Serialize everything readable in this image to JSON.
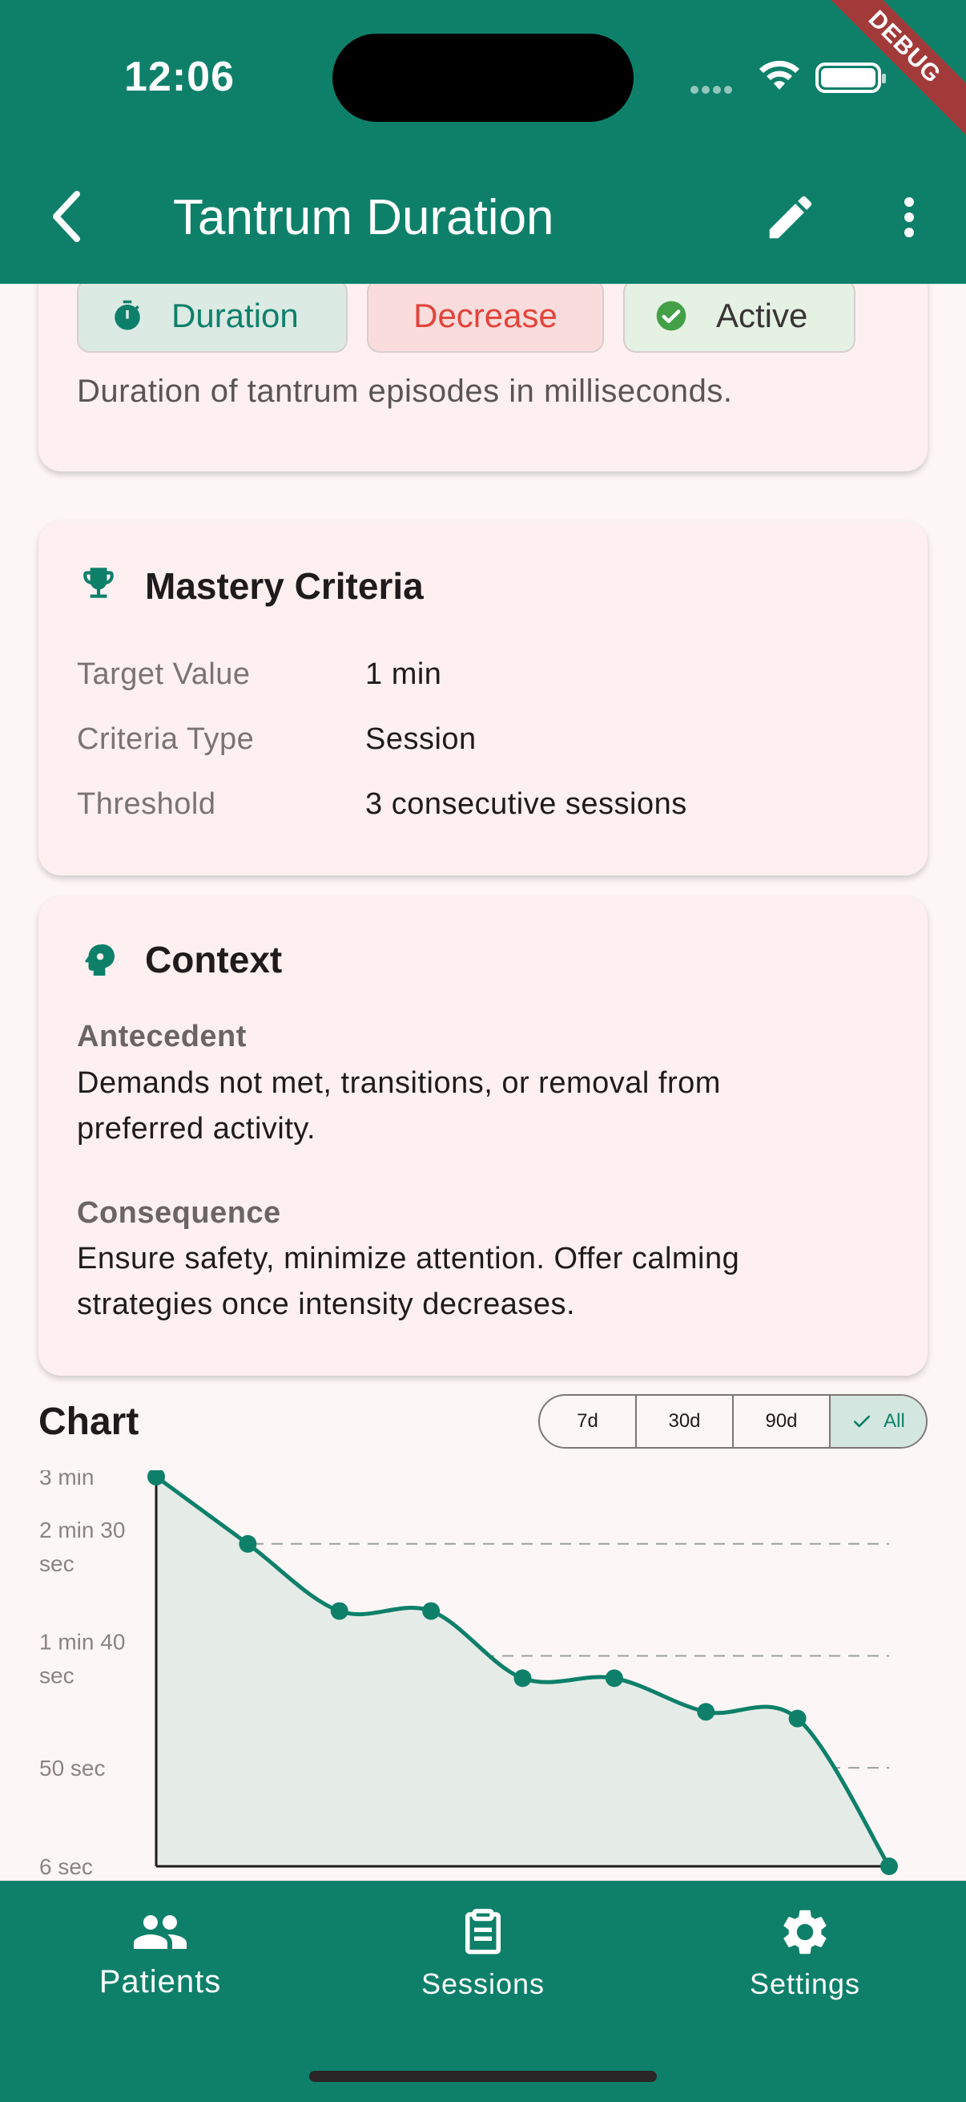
{
  "status_bar": {
    "time": "12:06",
    "debug_label": "DEBUG"
  },
  "app_bar": {
    "title": "Tantrum Duration",
    "back_icon": "chevron-left-icon",
    "edit_icon": "pencil-icon",
    "more_icon": "more-vert-icon"
  },
  "summary": {
    "chips": {
      "type": "Duration",
      "direction": "Decrease",
      "status": "Active"
    },
    "description": "Duration of tantrum episodes in milliseconds."
  },
  "mastery": {
    "title": "Mastery Criteria",
    "rows": [
      {
        "label": "Target Value",
        "value": "1 min"
      },
      {
        "label": "Criteria Type",
        "value": "Session"
      },
      {
        "label": "Threshold",
        "value": "3 consecutive sessions"
      }
    ]
  },
  "context": {
    "title": "Context",
    "antecedent_label": "Antecedent",
    "antecedent_line1": "Demands not met, transitions, or removal from",
    "antecedent_line2": "preferred activity.",
    "consequence_label": "Consequence",
    "consequence_line1": "Ensure safety, minimize attention. Offer calming",
    "consequence_line2": "strategies once intensity decreases."
  },
  "chart_section": {
    "title": "Chart",
    "ranges": [
      "7d",
      "30d",
      "90d",
      "All"
    ],
    "selected_range": "All"
  },
  "chart_data": {
    "type": "area",
    "y_unit": "seconds",
    "y_ticks": [
      {
        "value": 180,
        "label1": "3 min",
        "label2": ""
      },
      {
        "value": 150,
        "label1": "2 min 30",
        "label2": "sec"
      },
      {
        "value": 100,
        "label1": "1 min 40",
        "label2": "sec"
      },
      {
        "value": 50,
        "label1": "50 sec",
        "label2": ""
      },
      {
        "value": 6,
        "label1": "6 sec",
        "label2": ""
      }
    ],
    "ylim": [
      6,
      180
    ],
    "values": [
      180,
      150,
      120,
      120,
      90,
      90,
      75,
      72,
      6
    ],
    "grid": "horizontal dashed",
    "line_color": "#0E806A",
    "fill_color": "#E5ECE8"
  },
  "bottom_nav": {
    "items": [
      {
        "label": "Patients",
        "icon": "people-icon",
        "active": true
      },
      {
        "label": "Sessions",
        "icon": "clipboard-icon",
        "active": false
      },
      {
        "label": "Settings",
        "icon": "gear-icon",
        "active": false
      }
    ]
  },
  "colors": {
    "primary": "#0E806A",
    "card_bg": "#FEF0F0",
    "page_bg": "#FDF6F6"
  }
}
